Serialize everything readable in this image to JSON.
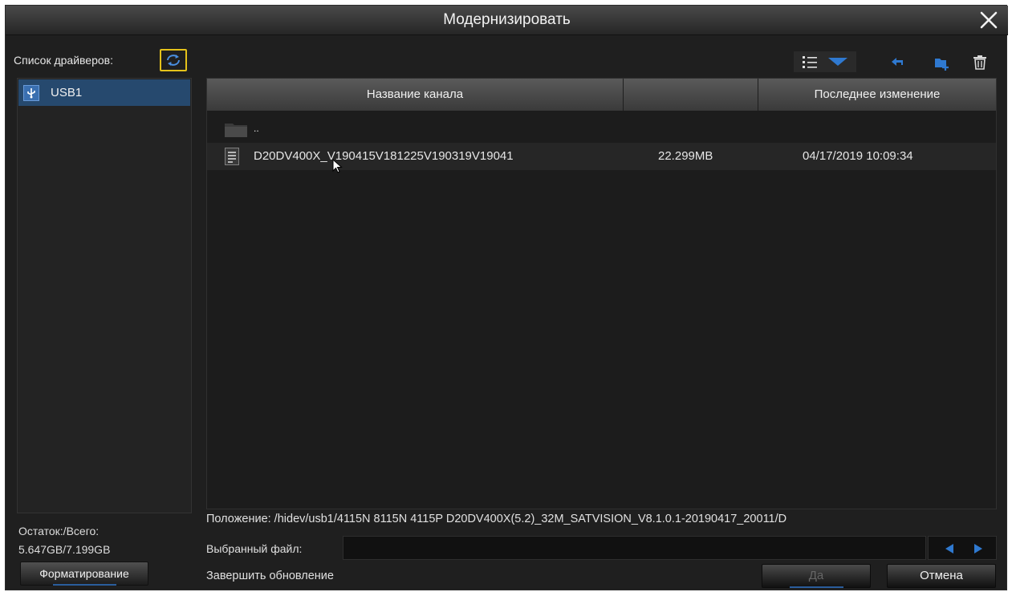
{
  "dialog": {
    "title": "Модернизировать",
    "close_icon": "close-icon"
  },
  "sidebar": {
    "drivers_label": "Список драйверов:",
    "refresh_icon": "refresh-icon",
    "drives": [
      {
        "label": "USB1",
        "icon": "usb-icon",
        "selected": true
      }
    ],
    "space_label": "Остаток:/Всего:",
    "space_value": "5.647GB/7.199GB",
    "format_label": "Форматирование"
  },
  "toolbar": {
    "view_icon": "list-view-icon",
    "back_icon": "back-arrow-icon",
    "new_folder_icon": "new-folder-icon",
    "delete_icon": "trash-icon"
  },
  "file_table": {
    "columns": [
      "Название канала",
      "",
      "Последнее изменение"
    ],
    "rows": [
      {
        "type": "folder",
        "name": "..",
        "size": "",
        "modified": ""
      },
      {
        "type": "file",
        "name": "D20DV400X_V190415V181225V190319V19041",
        "size": "22.299MB",
        "modified": "04/17/2019 10:09:34",
        "selected": true
      }
    ]
  },
  "footer": {
    "path": "Положение: /hidev/usb1/4115N 8115N 4115P D20DV400X(5.2)_32M_SATVISION_V8.1.0.1-20190417_20011/D",
    "selected_file_label": "Выбранный файл:",
    "selected_file_value": "",
    "finish_label": "Завершить обновление",
    "ok_label": "Да",
    "cancel_label": "Отмена"
  },
  "colors": {
    "accent": "#2a5d9c",
    "selection": "#26496e",
    "refresh_border": "#e5c21a",
    "icon_blue": "#2f79d0"
  }
}
